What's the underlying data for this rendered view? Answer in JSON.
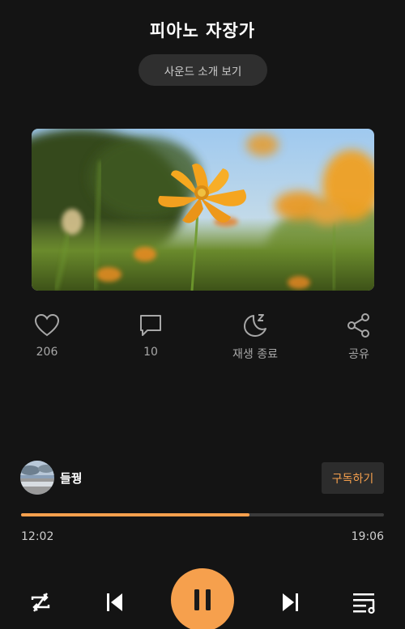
{
  "header": {
    "title": "피아노 자장가",
    "intro_button": "사운드 소개 보기"
  },
  "actions": [
    {
      "icon": "heart-icon",
      "label": "206"
    },
    {
      "icon": "comment-icon",
      "label": "10"
    },
    {
      "icon": "sleep-timer-icon",
      "label": "재생 종료"
    },
    {
      "icon": "share-icon",
      "label": "공유"
    }
  ],
  "artist": {
    "name": "들꿩",
    "subscribe_label": "구독하기"
  },
  "player": {
    "current_time": "12:02",
    "total_time": "19:06",
    "progress": 0.63,
    "state": "playing"
  },
  "colors": {
    "accent": "#f6a04d",
    "background": "#141414"
  }
}
